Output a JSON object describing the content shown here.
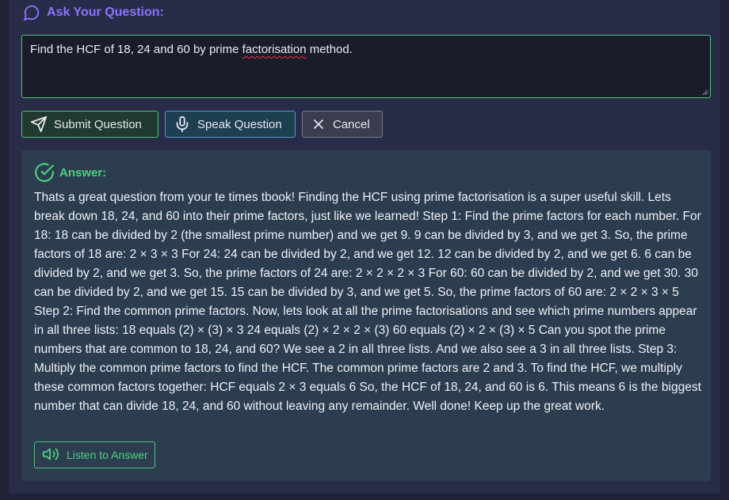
{
  "ask": {
    "label": "Ask Your Question:",
    "question_before": "Find the HCF of 18, 24 and 60 by prime ",
    "question_misspelled": "factorisation",
    "question_after": " method."
  },
  "buttons": {
    "submit": "Submit Question",
    "speak": "Speak Question",
    "cancel": "Cancel"
  },
  "answer": {
    "label": "Answer:",
    "text": "Thats a great question from your te times tbook! Finding the HCF using prime factorisation is a super useful skill. Lets break down 18, 24, and 60 into their prime factors, just like we learned! Step 1: Find the prime factors for each number. For 18: 18 can be divided by 2 (the smallest prime number) and we get 9. 9 can be divided by 3, and we get 3. So, the prime factors of 18 are: 2 × 3 × 3 For 24: 24 can be divided by 2, and we get 12. 12 can be divided by 2, and we get 6. 6 can be divided by 2, and we get 3. So, the prime factors of 24 are: 2 × 2 × 2 × 3 For 60: 60 can be divided by 2, and we get 30. 30 can be divided by 2, and we get 15. 15 can be divided by 3, and we get 5. So, the prime factors of 60 are: 2 × 2 × 3 × 5 Step 2: Find the common prime factors. Now, lets look at all the prime factorisations and see which prime numbers appear in all three lists: 18 equals (2) × (3) × 3 24 equals (2) × 2 × 2 × (3) 60 equals (2) × 2 × (3) × 5 Can you spot the prime numbers that are common to 18, 24, and 60? We see a 2 in all three lists. And we also see a 3 in all three lists. Step 3: Multiply the common prime factors to find the HCF. The common prime factors are 2 and 3. To find the HCF, we multiply these common factors together: HCF equals 2 × 3 equals 6 So, the HCF of 18, 24, and 60 is 6. This means 6 is the biggest number that can divide 18, 24, and 60 without leaving any remainder. Well done! Keep up the great work.",
    "listen": "Listen to Answer"
  },
  "colors": {
    "accent_purple": "#8a74ff",
    "accent_green": "#4bc37a",
    "accent_blue": "#3fa2c7"
  },
  "icons": {
    "ask": "chat-bubble-icon",
    "submit": "send-icon",
    "speak": "microphone-icon",
    "cancel": "close-icon",
    "answer": "check-circle-icon",
    "listen": "speaker-icon"
  }
}
